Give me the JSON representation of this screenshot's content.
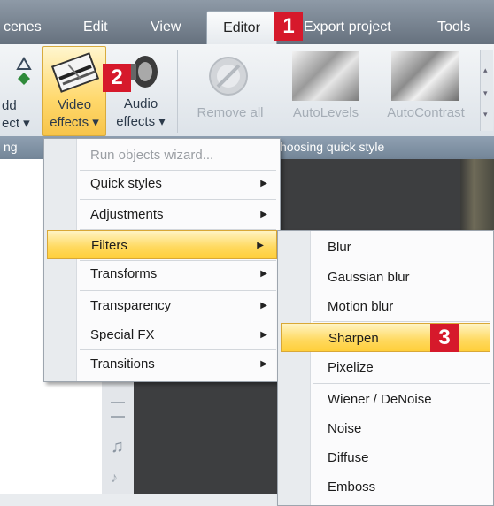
{
  "menubar": {
    "tabs": [
      {
        "label": "cenes"
      },
      {
        "label": "Edit"
      },
      {
        "label": "View"
      },
      {
        "label": "Editor"
      },
      {
        "label": "Export project"
      },
      {
        "label": "Tools"
      }
    ],
    "active_tab": "Editor"
  },
  "ribbon": {
    "add_button": {
      "line1": "dd",
      "line2": "ect ▾"
    },
    "video_effects": {
      "line1": "Video",
      "line2": "effects ▾"
    },
    "audio_effects": {
      "line1": "Audio",
      "line2": "effects ▾"
    },
    "remove_all": {
      "label": "Remove all"
    },
    "autolevels": {
      "label": "AutoLevels"
    },
    "autocontrast": {
      "label": "AutoContrast"
    },
    "group_left_label": "ng",
    "group_right_label": "hoosing quick style"
  },
  "badges": {
    "one": "1",
    "two": "2",
    "three": "3"
  },
  "video_effects_menu": {
    "items": [
      {
        "label": "Run objects wizard...",
        "disabled": true,
        "submenu": false
      },
      {
        "label": "Quick styles",
        "submenu": true
      },
      {
        "label": "Adjustments",
        "submenu": true
      },
      {
        "label": "Filters",
        "submenu": true,
        "highlighted": true
      },
      {
        "label": "Transforms",
        "submenu": true
      },
      {
        "label": "Transparency",
        "submenu": true
      },
      {
        "label": "Special FX",
        "submenu": true
      },
      {
        "label": "Transitions",
        "submenu": true
      }
    ]
  },
  "filters_submenu": {
    "items": [
      {
        "label": "Blur"
      },
      {
        "label": "Gaussian blur"
      },
      {
        "label": "Motion blur"
      },
      {
        "label": "Sharpen",
        "highlighted": true
      },
      {
        "label": "Pixelize"
      },
      {
        "label": "Wiener / DeNoise"
      },
      {
        "label": "Noise"
      },
      {
        "label": "Diffuse"
      },
      {
        "label": "Emboss"
      }
    ]
  },
  "colors": {
    "badge_red": "#d6192b",
    "highlight": "#ffd95e"
  }
}
